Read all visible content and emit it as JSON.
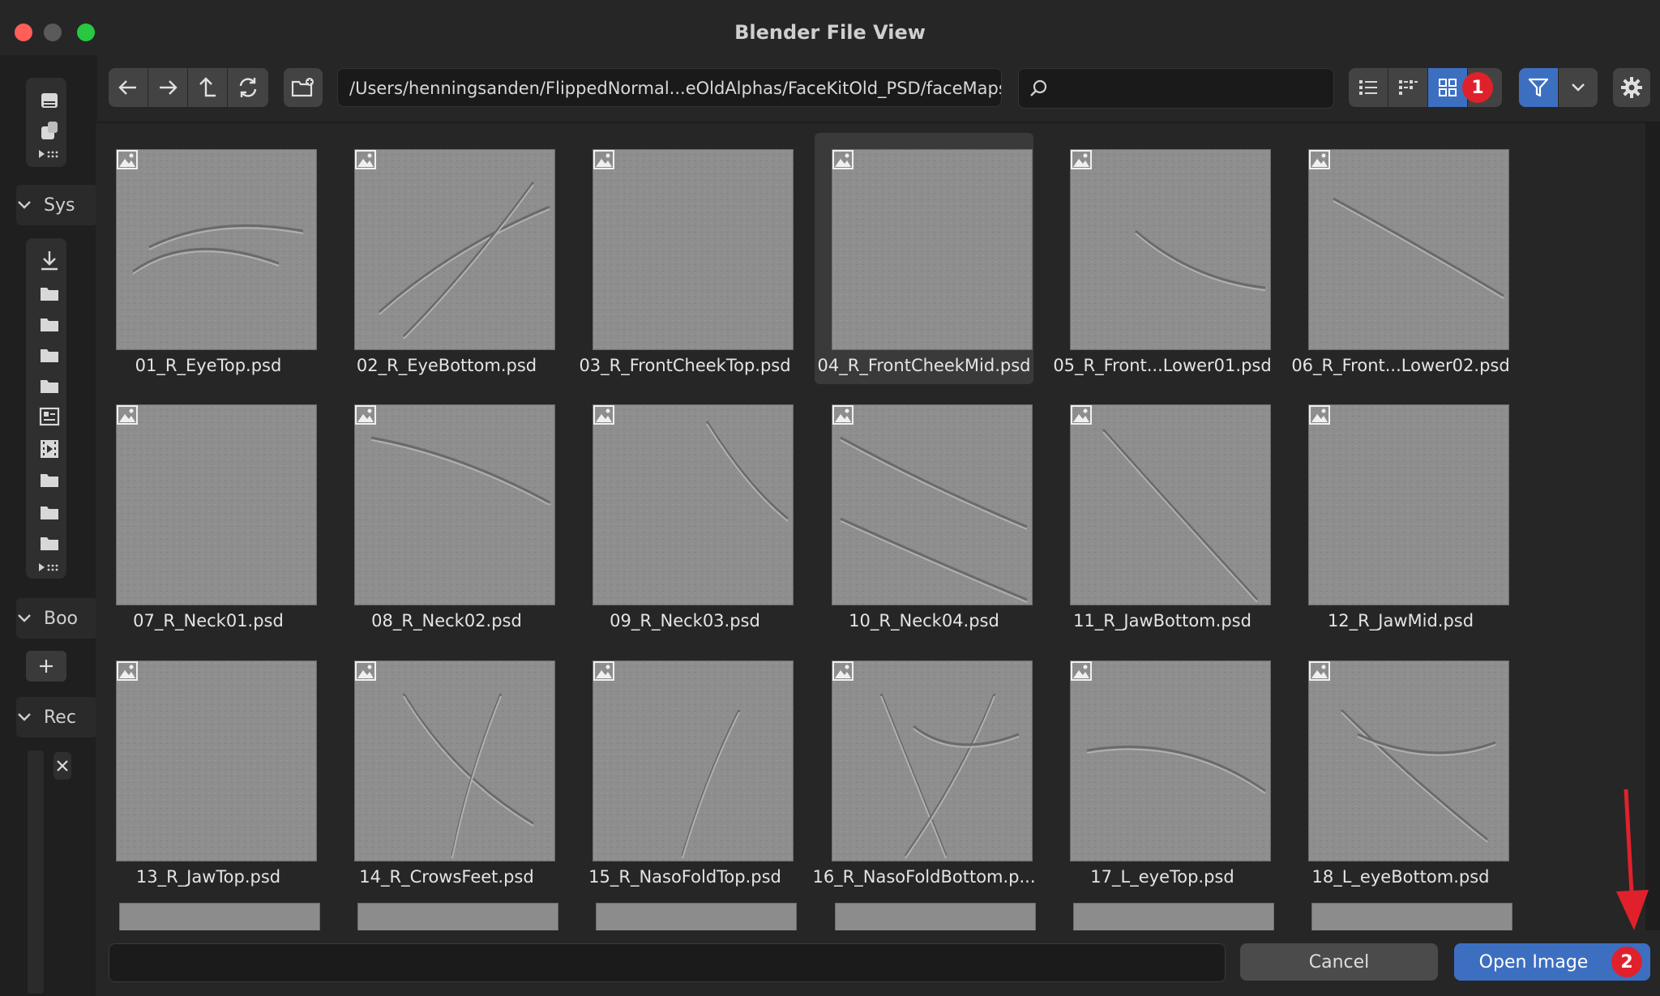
{
  "window": {
    "title": "Blender File View"
  },
  "sidebar": {
    "sections": [
      {
        "label": "Sys"
      },
      {
        "label": "Boo"
      },
      {
        "label": "Rec"
      }
    ]
  },
  "toolbar": {
    "path": "/Users/henningsanden/FlippedNormal...eOldAlphas/FaceKitOld_PSD/faceMaps/",
    "search_value": ""
  },
  "files": [
    {
      "name": "01_R_EyeTop.psd"
    },
    {
      "name": "02_R_EyeBottom.psd"
    },
    {
      "name": "03_R_FrontCheekTop.psd"
    },
    {
      "name": "04_R_FrontCheekMid.psd"
    },
    {
      "name": "05_R_Front...Lower01.psd"
    },
    {
      "name": "06_R_Front...Lower02.psd"
    },
    {
      "name": "07_R_Neck01.psd"
    },
    {
      "name": "08_R_Neck02.psd"
    },
    {
      "name": "09_R_Neck03.psd"
    },
    {
      "name": "10_R_Neck04.psd"
    },
    {
      "name": "11_R_JawBottom.psd"
    },
    {
      "name": "12_R_JawMid.psd"
    },
    {
      "name": "13_R_JawTop.psd"
    },
    {
      "name": "14_R_CrowsFeet.psd"
    },
    {
      "name": "15_R_NasoFoldTop.psd"
    },
    {
      "name": "16_R_NasoFoldBottom.p..."
    },
    {
      "name": "17_L_eyeTop.psd"
    },
    {
      "name": "18_L_eyeBottom.psd"
    }
  ],
  "selected_index": 3,
  "footer": {
    "filename_value": "",
    "cancel_label": "Cancel",
    "open_label": "Open Image"
  },
  "annotations": {
    "badge1": "1",
    "badge2": "2",
    "color": "#e0212b"
  },
  "colors": {
    "accent": "#3d6fc1",
    "filter_active": "#3d6fc1"
  }
}
